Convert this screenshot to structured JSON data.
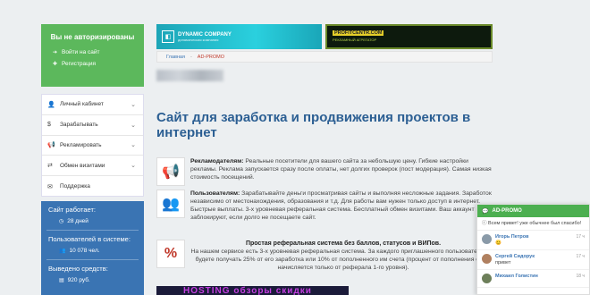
{
  "auth": {
    "title": "Вы не авторизированы",
    "items": [
      {
        "icon": "login-icon",
        "label": "Войти на сайт"
      },
      {
        "icon": "user-plus-icon",
        "label": "Регистрация"
      }
    ]
  },
  "menu": {
    "items": [
      {
        "icon": "user-icon",
        "label": "Личный кабинет"
      },
      {
        "icon": "dollar-icon",
        "label": "Зарабатывать"
      },
      {
        "icon": "megaphone-icon",
        "label": "Рекламировать"
      },
      {
        "icon": "exchange-icon",
        "label": "Обмен визитами"
      },
      {
        "icon": "support-icon",
        "label": "Поддержка"
      }
    ]
  },
  "stats": {
    "uptime_label": "Сайт работает:",
    "uptime_value": "28 дней",
    "users_label": "Пользователей в системе:",
    "users_value": "10 078 чел.",
    "paid_label": "Выведено средств:",
    "paid_value": "920 руб."
  },
  "banners": {
    "b1_title": "DYNAMIC COMPANY",
    "b1_sub": "динамическая компания",
    "b2_title": "PROFITCENTR.COM",
    "b2_sub": "РЕКЛАМНЫЙ АГРЕГАТОР"
  },
  "breadcrumb": {
    "home": "Главная",
    "separator": "-",
    "current": "AD-PROMO"
  },
  "headline": "Сайт для заработка и продвижения проектов в интернет",
  "features": [
    {
      "icon": "megaphone-icon",
      "title": "Рекламодателям:",
      "text": "Реальные посетители для вашего сайта за небольшую цену. Гибкие настройки рекламы. Реклама запускается сразу после оплаты, нет долгих проверок (пост модерация). Самая низкая стоимость посещений."
    },
    {
      "icon": "users-icon",
      "title": "Пользователям:",
      "text": "Зарабатывайте деньги просматривая сайты и выполняя несложные задания. Заработок независимо от местонахождения, образования и т.д. Для работы вам нужен только доступ в интернет. Быстрые выплаты. 3-х уровневая реферальная система. Бесплатный обмен визитами. Ваш аккаунт не заблокируют, если долго не посещаете сайт."
    },
    {
      "icon": "percent-icon",
      "title": "Простая реферальная система без баллов, статусов и ВИПов.",
      "text": "На нашем сервисе есть 3-х уровневая реферальная система. За каждого приглашенного пользователя, Вы будете получать 25% от его заработка или 10% от пополненного им счета (процент от пополнения счета начисляется только от реферала 1-го уровня)."
    }
  ],
  "bottom_banner": {
    "text": "HOSTING обзоры скидки"
  },
  "chat": {
    "title": "AD-PROMO",
    "welcome": "Всем привет! уже обычнее был спасибо!",
    "messages": [
      {
        "name": "Игорь Петров",
        "text": "😊",
        "time": "17 ч"
      },
      {
        "name": "Сергей Сидорук",
        "text": "привет",
        "time": "17 ч"
      },
      {
        "name": "Михаил Голистин",
        "text": "",
        "time": "18 ч"
      }
    ]
  }
}
